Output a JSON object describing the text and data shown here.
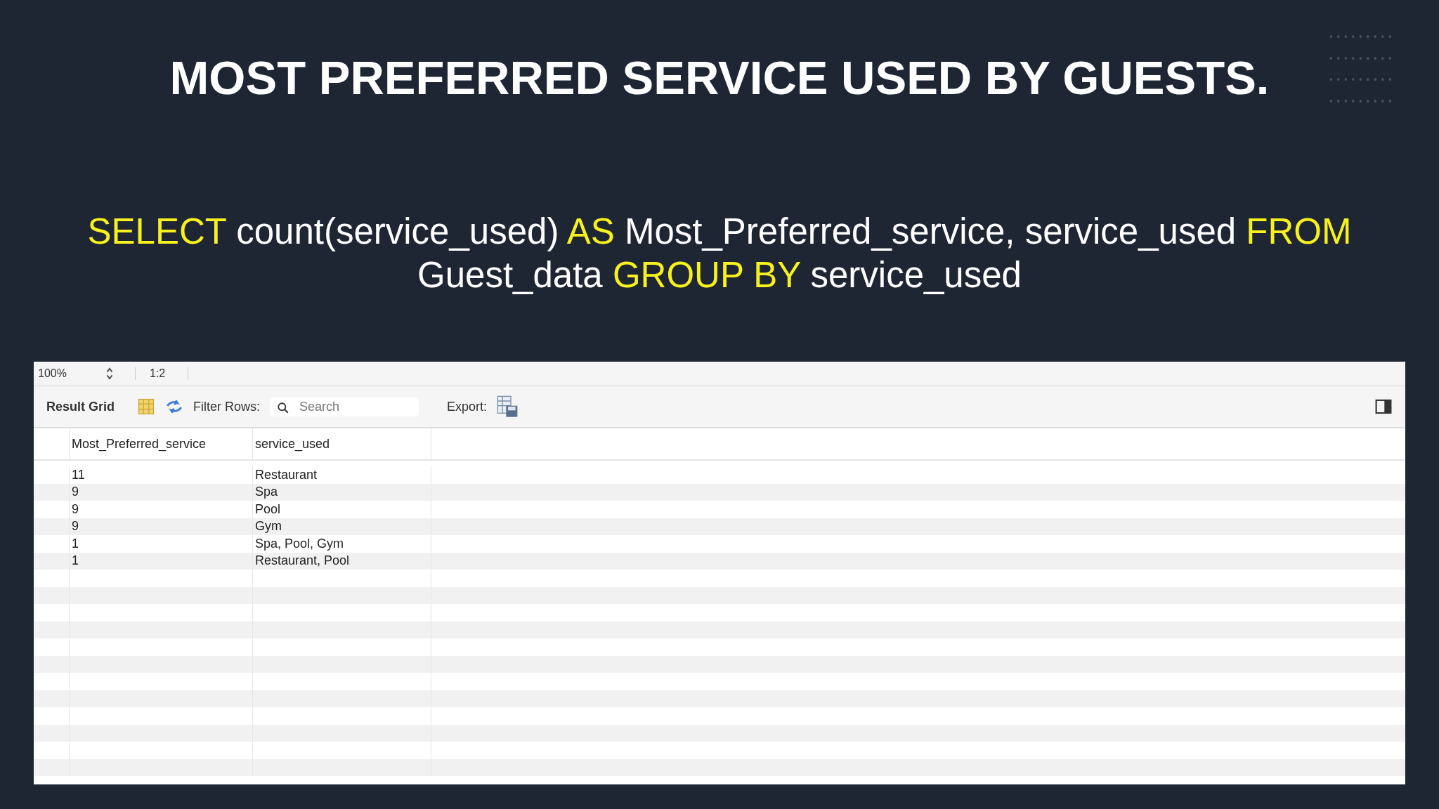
{
  "slide_title": "MOST PREFERRED SERVICE USED BY GUESTS.",
  "query": [
    {
      "kind": "keyword",
      "text": "SELECT"
    },
    {
      "kind": "plain",
      "text": "count(service_used)"
    },
    {
      "kind": "keyword",
      "text": "AS"
    },
    {
      "kind": "plain",
      "text": "Most_Preferred_service, service_used"
    },
    {
      "kind": "keyword",
      "text": "FROM"
    },
    {
      "kind": "plain",
      "text": "Guest_data"
    },
    {
      "kind": "keyword",
      "text": "GROUP BY"
    },
    {
      "kind": "plain",
      "text": "service_used"
    }
  ],
  "top_bar": {
    "zoom": "100%",
    "ratio": "1:2"
  },
  "toolbar": {
    "title": "Result Grid",
    "filter_label": "Filter Rows:",
    "search_placeholder": "Search",
    "export_label": "Export:"
  },
  "table": {
    "columns": [
      "Most_Preferred_service",
      "service_used"
    ],
    "rows": [
      [
        "11",
        "Restaurant"
      ],
      [
        "9",
        "Spa"
      ],
      [
        "9",
        "Pool"
      ],
      [
        "9",
        "Gym"
      ],
      [
        "1",
        "Spa, Pool, Gym"
      ],
      [
        "1",
        "Restaurant, Pool"
      ]
    ]
  }
}
